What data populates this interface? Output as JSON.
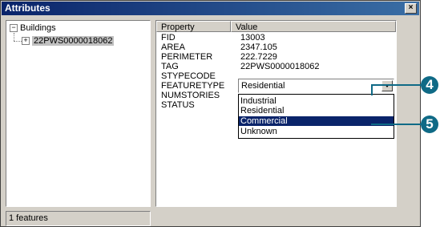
{
  "window": {
    "title": "Attributes",
    "close_glyph": "×"
  },
  "tree": {
    "root": {
      "expander": "−",
      "label": "Buildings"
    },
    "child": {
      "expander": "+",
      "label": "22PWS0000018062"
    }
  },
  "status_bar": {
    "text": "1 features"
  },
  "grid": {
    "headers": {
      "property": "Property",
      "value": "Value"
    },
    "rows": [
      {
        "name": "FID",
        "value": "13003"
      },
      {
        "name": "AREA",
        "value": "2347.105"
      },
      {
        "name": "PERIMETER",
        "value": "222.7229"
      },
      {
        "name": "TAG",
        "value": "22PWS0000018062"
      },
      {
        "name": "STYPECODE",
        "value": ""
      },
      {
        "name": "FEATURETYPE",
        "value": ""
      },
      {
        "name": "NUMSTORIES",
        "value": ""
      },
      {
        "name": "STATUS",
        "value": ""
      }
    ]
  },
  "combo": {
    "selected": "Residential",
    "options": [
      "Industrial",
      "Residential",
      "Commercial",
      "Unknown"
    ],
    "highlighted": "Commercial"
  },
  "callouts": {
    "first": "4",
    "second": "5"
  },
  "colors": {
    "callout": "#0f6a86",
    "highlight": "#0a246a",
    "title_bar": "#0a246a"
  }
}
